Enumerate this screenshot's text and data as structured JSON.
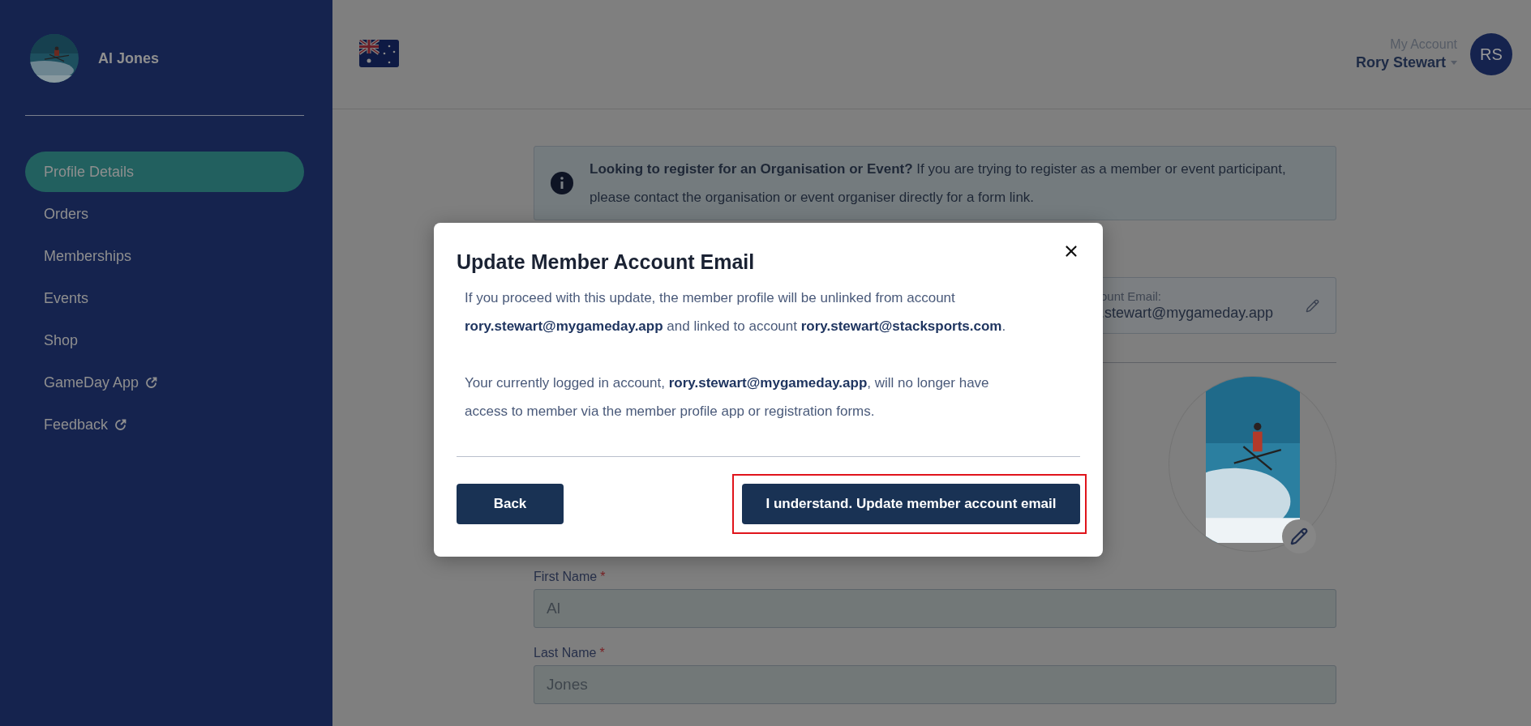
{
  "sidebar": {
    "user": {
      "name": "Al Jones"
    },
    "items": [
      {
        "label": "Profile Details",
        "selected": true,
        "external": false
      },
      {
        "label": "Orders",
        "selected": false,
        "external": false
      },
      {
        "label": "Memberships",
        "selected": false,
        "external": false
      },
      {
        "label": "Events",
        "selected": false,
        "external": false
      },
      {
        "label": "Shop",
        "selected": false,
        "external": false
      },
      {
        "label": "GameDay App",
        "selected": false,
        "external": true
      },
      {
        "label": "Feedback",
        "selected": false,
        "external": true
      }
    ]
  },
  "header": {
    "account_label": "My Account",
    "account_name": "Rory Stewart",
    "avatar_initials": "RS"
  },
  "info_banner": {
    "text": "**Looking to register for an Organisation or Event?** If you are trying to register as a member or event participant, please contact the organisation or event organiser directly for a form link."
  },
  "account_email": {
    "label": "ount Email:",
    "value": ".stewart@mygameday.app"
  },
  "form": {
    "fields": [
      {
        "label": "First Name",
        "required_mark": "*",
        "value": "Al"
      },
      {
        "label": "Last Name",
        "required_mark": "*",
        "value": "Jones"
      }
    ]
  },
  "modal": {
    "title": "Update Member Account Email",
    "paragraphs": [
      "If you proceed with this update, the member profile will be unlinked from account **rory.stewart@mygameday.app** and linked to account **rory.stewart@stacksports.com**.",
      "Your currently logged in account, **rory.stewart@mygameday.app**, will no longer have access to member via the member profile app or registration forms."
    ],
    "buttons": [
      {
        "label": "Back",
        "kind": "secondary",
        "highlighted": false
      },
      {
        "label": "I understand. Update member account email",
        "kind": "primary",
        "highlighted": true
      }
    ]
  }
}
